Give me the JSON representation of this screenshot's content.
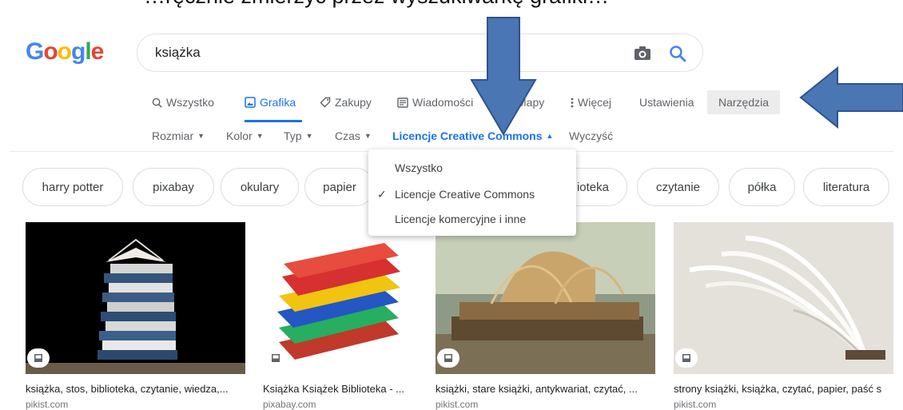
{
  "caption_top": "…ręcznie zmierzyć przez wyszukiwarkę grafiki…",
  "logo": {
    "text": "Google"
  },
  "search": {
    "query": "książka"
  },
  "tabs": [
    {
      "label": "Wszystko",
      "icon": "search-icon"
    },
    {
      "label": "Grafika",
      "icon": "image-icon",
      "active": true
    },
    {
      "label": "Zakupy",
      "icon": "tag-icon"
    },
    {
      "label": "Wiadomości",
      "icon": "news-icon"
    },
    {
      "label": "Mapy",
      "icon": "map-icon"
    },
    {
      "label": "Więcej",
      "icon": "more-vert-icon"
    },
    {
      "label": "Ustawienia"
    }
  ],
  "tools_label": "Narzędzia",
  "filters": [
    {
      "label": "Rozmiar"
    },
    {
      "label": "Kolor"
    },
    {
      "label": "Typ"
    },
    {
      "label": "Czas"
    },
    {
      "label": "Licencje Creative Commons",
      "active": true
    },
    {
      "label": "Wyczyść"
    }
  ],
  "chips": [
    "harry potter",
    "pixabay",
    "okulary",
    "papier",
    "biblioteka",
    "czytanie",
    "półka",
    "literatura"
  ],
  "license_dropdown": {
    "options": [
      "Wszystko",
      "Licencje Creative Commons",
      "Licencje komercyjne i inne"
    ],
    "selected": "Licencje Creative Commons"
  },
  "results": [
    {
      "caption": "książka, stos, biblioteka, czytanie, wiedza,...",
      "source": "pikist.com"
    },
    {
      "caption": "Książka Książek Biblioteka - ...",
      "source": "pixabay.com"
    },
    {
      "caption": "książki, stare książki, antykwariat, czytać, ...",
      "source": "pikist.com"
    },
    {
      "caption": "strony książki, książka, czytać, papier, paść s",
      "source": "pikist.com"
    }
  ],
  "colors": {
    "accent": "#1a73e8",
    "arrow_fill": "#4a76b3",
    "arrow_stroke": "#2f528f"
  }
}
